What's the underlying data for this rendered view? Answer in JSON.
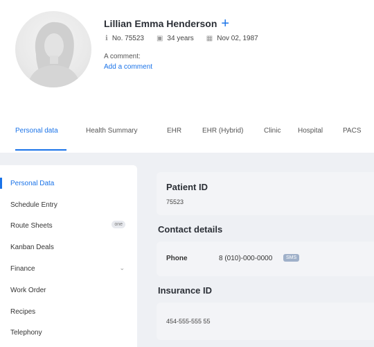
{
  "patient": {
    "name": "Lillian Emma Henderson",
    "number": "No. 75523",
    "age": "34 years",
    "birth_date": "Nov 02, 1987",
    "comment_label": "A comment:",
    "comment_link": "Add a comment"
  },
  "tabs": [
    {
      "label": "Personal data",
      "active": true
    },
    {
      "label": "Health Summary"
    },
    {
      "label": "EHR"
    },
    {
      "label": "EHR (Hybrid)"
    },
    {
      "label": "Clinic"
    },
    {
      "label": "Hospital"
    },
    {
      "label": "PACS"
    }
  ],
  "sidebar": {
    "items": [
      {
        "label": "Personal Data",
        "active": true
      },
      {
        "label": "Schedule Entry"
      },
      {
        "label": "Route Sheets",
        "badge": "one"
      },
      {
        "label": "Kanban Deals"
      },
      {
        "label": "Finance",
        "expandable": true
      },
      {
        "label": "Work Order"
      },
      {
        "label": "Recipes"
      },
      {
        "label": "Telephony"
      }
    ]
  },
  "main": {
    "patient_id_title": "Patient ID",
    "patient_id_value": "75523",
    "contact_title": "Contact details",
    "phone_label": "Phone",
    "phone_value": "8 (010)-000-0000",
    "sms_label": "SMS",
    "insurance_title": "Insurance ID",
    "insurance_value": "454-555-555 55"
  },
  "colors": {
    "accent": "#1a73e8",
    "background": "#eef0f4",
    "card": "#f3f4f7"
  }
}
